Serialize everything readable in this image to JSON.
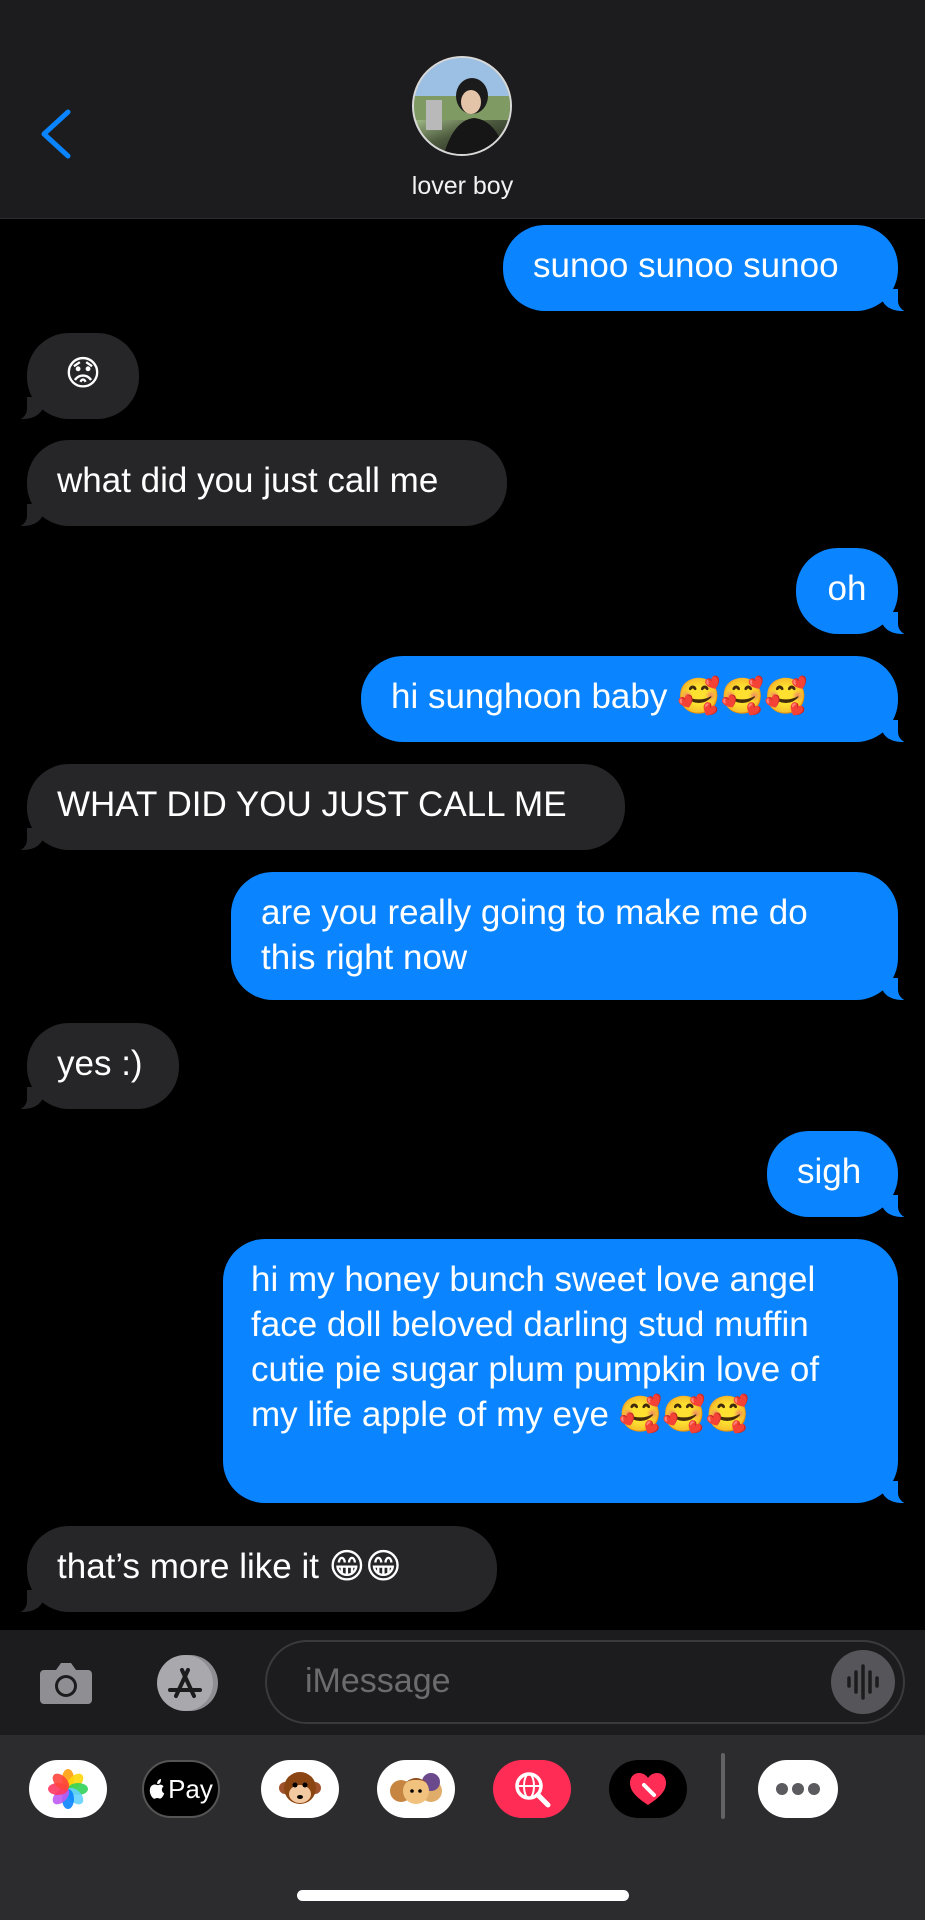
{
  "header": {
    "contact_name": "lover boy"
  },
  "messages": [
    {
      "from": "me",
      "text": "sunoo sunoo sunoo"
    },
    {
      "from": "them",
      "text": "😟"
    },
    {
      "from": "them",
      "text": "what did you just call me"
    },
    {
      "from": "me",
      "text": "oh"
    },
    {
      "from": "me",
      "text": "hi sunghoon baby 🥰🥰🥰"
    },
    {
      "from": "them",
      "text": "WHAT DID YOU JUST CALL ME"
    },
    {
      "from": "me",
      "text": "are you really going to make me do this right now"
    },
    {
      "from": "them",
      "text": "yes :)"
    },
    {
      "from": "me",
      "text": "sigh"
    },
    {
      "from": "me",
      "text": "hi my honey bunch sweet love angel face doll beloved darling stud muffin cutie pie sugar plum pumpkin love of my life apple of my eye 🥰🥰🥰"
    },
    {
      "from": "them",
      "text": "that’s more like it 😁😁"
    }
  ],
  "composer": {
    "placeholder": "iMessage"
  },
  "app_drawer": {
    "apps": [
      {
        "name": "photos-icon"
      },
      {
        "name": "apple-pay-icon",
        "label": "Pay"
      },
      {
        "name": "animoji-icon"
      },
      {
        "name": "memoji-icon"
      },
      {
        "name": "image-search-icon"
      },
      {
        "name": "digital-touch-icon"
      },
      {
        "name": "more-apps-icon"
      }
    ]
  },
  "colors": {
    "sent_bubble": "#0a84ff",
    "received_bubble": "#262628",
    "header_bg": "#1c1c1e",
    "accent": "#0a84ff"
  }
}
